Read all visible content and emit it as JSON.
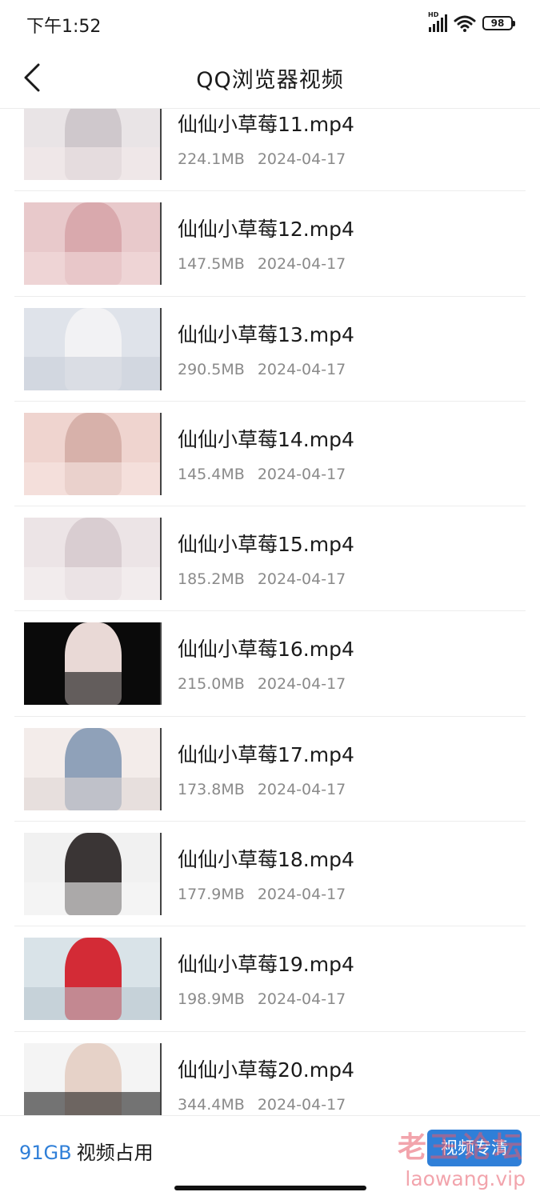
{
  "status_bar": {
    "time": "下午1:52",
    "network_label": "HD",
    "battery": "98"
  },
  "header": {
    "title": "QQ浏览器视频"
  },
  "videos": [
    {
      "name": "仙仙小草莓11.mp4",
      "size": "224.1MB",
      "date": "2024-04-17"
    },
    {
      "name": "仙仙小草莓12.mp4",
      "size": "147.5MB",
      "date": "2024-04-17"
    },
    {
      "name": "仙仙小草莓13.mp4",
      "size": "290.5MB",
      "date": "2024-04-17"
    },
    {
      "name": "仙仙小草莓14.mp4",
      "size": "145.4MB",
      "date": "2024-04-17"
    },
    {
      "name": "仙仙小草莓15.mp4",
      "size": "185.2MB",
      "date": "2024-04-17"
    },
    {
      "name": "仙仙小草莓16.mp4",
      "size": "215.0MB",
      "date": "2024-04-17"
    },
    {
      "name": "仙仙小草莓17.mp4",
      "size": "173.8MB",
      "date": "2024-04-17"
    },
    {
      "name": "仙仙小草莓18.mp4",
      "size": "177.9MB",
      "date": "2024-04-17"
    },
    {
      "name": "仙仙小草莓19.mp4",
      "size": "198.9MB",
      "date": "2024-04-17"
    },
    {
      "name": "仙仙小草莓20.mp4",
      "size": "344.4MB",
      "date": "2024-04-17"
    }
  ],
  "footer": {
    "storage_size": "91GB",
    "storage_label": "视频占用",
    "clean_button": "视频专清"
  },
  "watermark": {
    "title": "老王论坛",
    "url": "laowang.vip"
  },
  "colors": {
    "accent": "#2f7fd8",
    "watermark": "#e85a6a"
  }
}
